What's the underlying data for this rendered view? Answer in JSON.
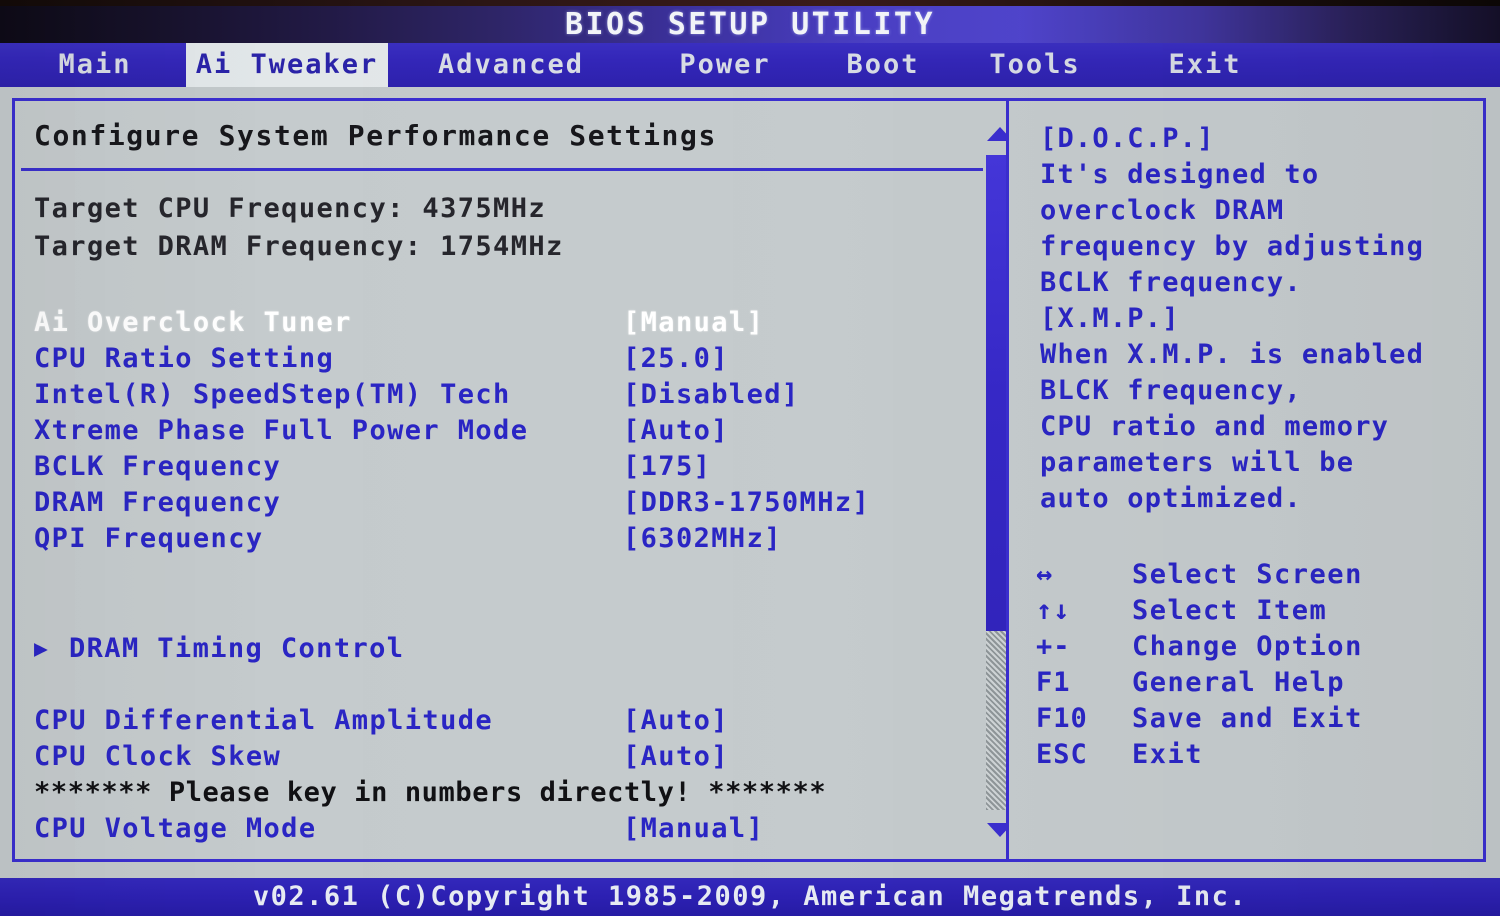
{
  "header": {
    "title": "BIOS SETUP UTILITY"
  },
  "menu": {
    "tabs": [
      {
        "label": "Main",
        "active": false
      },
      {
        "label": "Ai Tweaker",
        "active": true
      },
      {
        "label": "Advanced",
        "active": false
      },
      {
        "label": "Power",
        "active": false
      },
      {
        "label": "Boot",
        "active": false
      },
      {
        "label": "Tools",
        "active": false
      },
      {
        "label": "Exit",
        "active": false
      }
    ]
  },
  "main": {
    "heading": "Configure System Performance Settings",
    "info": [
      "Target CPU Frequency: 4375MHz",
      "Target DRAM Frequency: 1754MHz"
    ],
    "settings": [
      {
        "label": "Ai Overclock Tuner",
        "value": "[Manual]",
        "selected": true,
        "submenu": false
      },
      {
        "label": "CPU Ratio Setting",
        "value": "[25.0]",
        "selected": false,
        "submenu": false
      },
      {
        "label": "Intel(R) SpeedStep(TM) Tech",
        "value": "[Disabled]",
        "selected": false,
        "submenu": false
      },
      {
        "label": "Xtreme Phase Full Power Mode",
        "value": "[Auto]",
        "selected": false,
        "submenu": false
      },
      {
        "label": "BCLK Frequency",
        "value": "[175]",
        "selected": false,
        "submenu": false
      },
      {
        "label": "DRAM Frequency",
        "value": "[DDR3-1750MHz]",
        "selected": false,
        "submenu": false
      },
      {
        "label": "QPI Frequency",
        "value": "[6302MHz]",
        "selected": false,
        "submenu": false
      }
    ],
    "submenu": {
      "label": "DRAM Timing Control",
      "caret": "▶"
    },
    "settings2": [
      {
        "label": "CPU Differential Amplitude",
        "value": "[Auto]"
      },
      {
        "label": "CPU Clock Skew",
        "value": "[Auto]"
      }
    ],
    "notice": "******* Please key in numbers directly! *******",
    "settings3": [
      {
        "label": "CPU Voltage Mode",
        "value": "[Manual]"
      }
    ]
  },
  "help": {
    "lines": [
      " [D.O.C.P.]",
      "It's designed to",
      "overclock DRAM",
      "frequency by adjusting",
      "BCLK frequency.",
      " [X.M.P.]",
      "When X.M.P. is enabled",
      "BLCK frequency,",
      "CPU ratio and memory",
      "parameters will be",
      "auto optimized."
    ],
    "keys": [
      {
        "key": "↔",
        "desc": "Select Screen"
      },
      {
        "key": "↑↓",
        "desc": "Select Item"
      },
      {
        "key": "+-",
        "desc": "Change Option"
      },
      {
        "key": "F1",
        "desc": "General Help"
      },
      {
        "key": "F10",
        "desc": "Save and Exit"
      },
      {
        "key": "ESC",
        "desc": "Exit"
      }
    ]
  },
  "footer": {
    "copyright": "v02.61  (C)Copyright 1985-2009, American Megatrends, Inc."
  },
  "colors": {
    "text_blue": "#2a25c4",
    "border_blue": "#3a2ecf",
    "panel_bg": "#c5cbcd",
    "selected_text": "#ffffff",
    "heading_text": "#17171b"
  }
}
